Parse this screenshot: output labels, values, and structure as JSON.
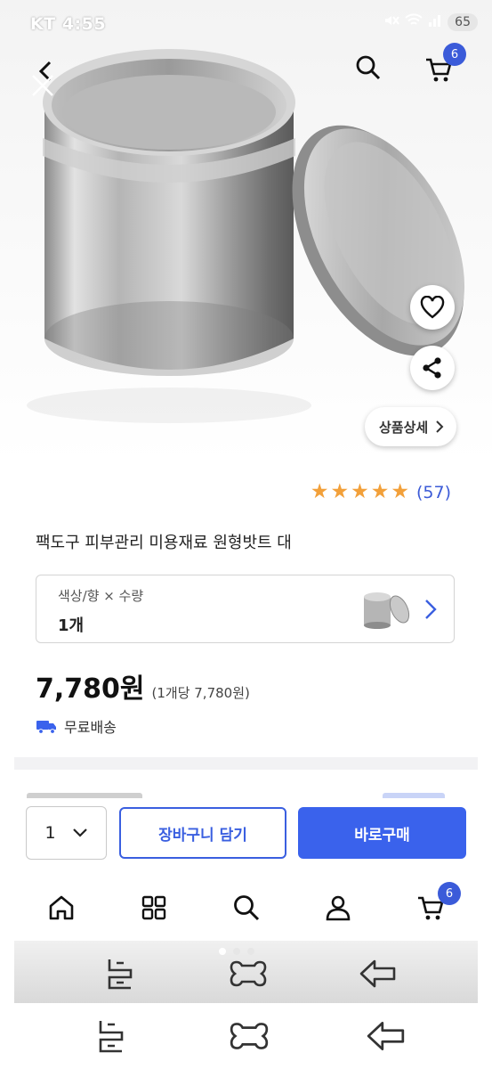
{
  "status_bar": {
    "carrier": "KT",
    "time": "4:55",
    "battery": "65"
  },
  "header": {
    "cart_badge": "6"
  },
  "product": {
    "detail_button": "상품상세",
    "rating_count": "(57)",
    "rating_stars": 5,
    "title": "팩도구 피부관리 미용재료 원형밧트 대",
    "option": {
      "label": "색상/향 × 수량",
      "value": "1개"
    },
    "price": "7,780원",
    "unit_price": "(1개당 7,780원)",
    "shipping": "무료배송"
  },
  "buy_bar": {
    "quantity": "1",
    "cart_button": "장바구니 담기",
    "buy_button": "바로구매"
  },
  "bottom_nav": {
    "cart_badge": "6"
  },
  "colors": {
    "accent": "#3a62ec",
    "star": "#f2a03a",
    "badge": "#3b5bd9"
  }
}
